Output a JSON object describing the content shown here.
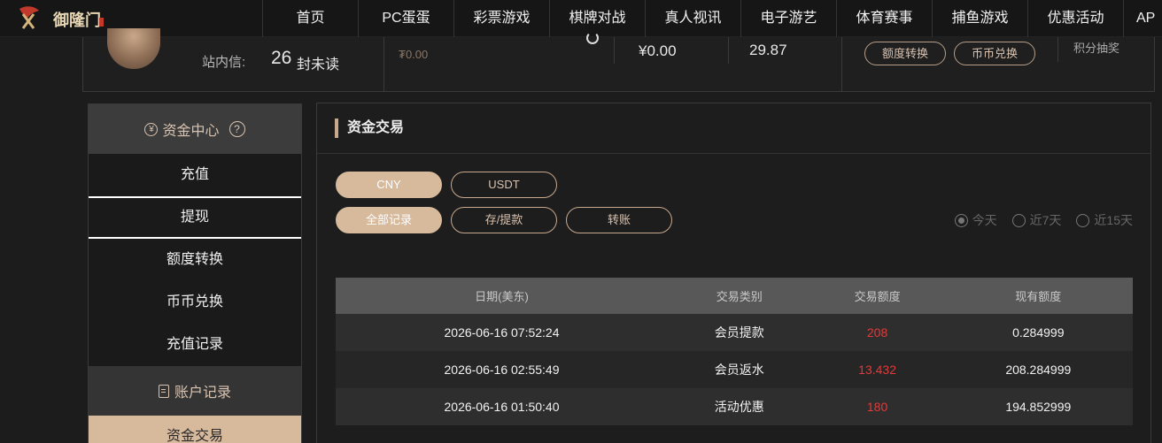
{
  "nav": {
    "logo_text": "御隆门",
    "items": [
      "首页",
      "PC蛋蛋",
      "彩票游戏",
      "棋牌对战",
      "真人视讯",
      "电子游艺",
      "体育赛事",
      "捕鱼游戏",
      "优惠活动",
      "AP"
    ]
  },
  "account": {
    "msg_label": "站内信:",
    "msg_count": "26",
    "msg_unit": "封未读",
    "cny_balance": "₮0.00",
    "balance1": "¥0.00",
    "balance2": "29.87",
    "btn_transfer": "额度转换",
    "btn_exchange": "币币兑换",
    "points_text": "积分抽奖"
  },
  "sidebar": {
    "group1_title": "资金中心",
    "group1_icon": "yen-circle-icon",
    "help_icon": "?",
    "items": [
      "充值",
      "提现",
      "额度转换",
      "币币兑换",
      "充值记录"
    ],
    "group2_title": "账户记录",
    "active_item": "资金交易"
  },
  "main": {
    "title": "资金交易",
    "currency_tabs": [
      "CNY",
      "USDT"
    ],
    "record_tabs": [
      "全部记录",
      "存/提款",
      "转账"
    ],
    "ranges": [
      "今天",
      "近7天",
      "近15天"
    ],
    "selected_range": "今天",
    "table": {
      "headers": [
        "日期(美东)",
        "交易类别",
        "交易额度",
        "现有额度"
      ],
      "rows": [
        [
          "2026-06-16 07:52:24",
          "会员提款",
          "208",
          "0.284999"
        ],
        [
          "2026-06-16 02:55:49",
          "会员返水",
          "13.432",
          "208.284999"
        ],
        [
          "2026-06-16 01:50:40",
          "活动优惠",
          "180",
          "194.852999"
        ]
      ]
    }
  },
  "colors": {
    "accent": "#d7b99c",
    "amount_red": "#e13a3a",
    "bg": "#1c1c1c"
  }
}
